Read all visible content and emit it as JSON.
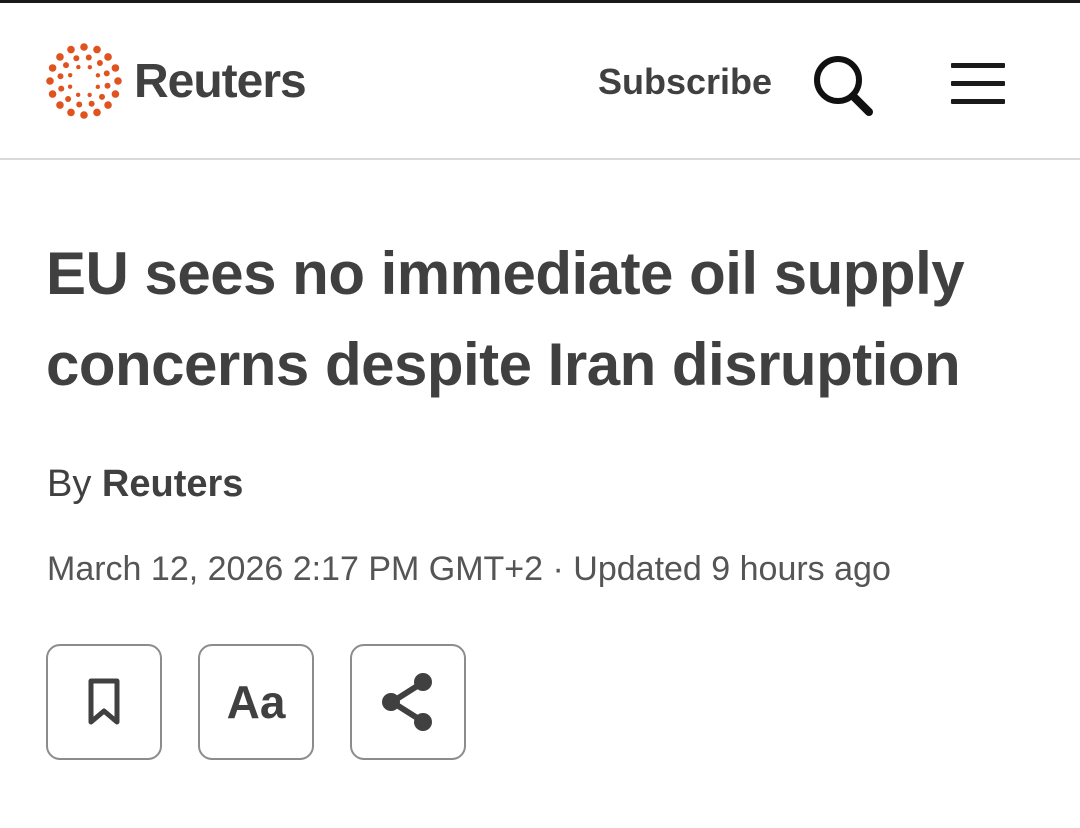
{
  "header": {
    "brand": "Reuters",
    "subscribe_label": "Subscribe",
    "icons": {
      "logo": "reuters-dot-ring-icon",
      "search": "search-icon",
      "menu": "hamburger-menu-icon"
    },
    "logo_color": "#e0531f"
  },
  "article": {
    "headline": "EU sees no immediate oil supply concerns despite Iran disruption",
    "byline_prefix": "By",
    "byline_author": "Reuters",
    "dateline": "March 12, 2026 2:17 PM GMT+2 · Updated 9 hours ago"
  },
  "actions": [
    {
      "icon": "bookmark-icon",
      "label": ""
    },
    {
      "icon": "text-size-icon",
      "label": "Aa"
    },
    {
      "icon": "share-icon",
      "label": ""
    }
  ]
}
